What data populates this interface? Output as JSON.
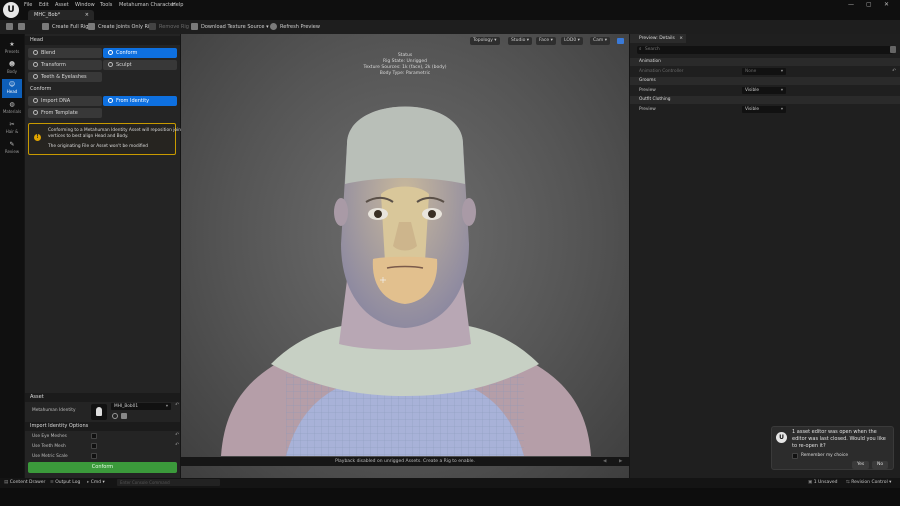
{
  "menu": {
    "file": "File",
    "edit": "Edit",
    "asset": "Asset",
    "window": "Window",
    "tools": "Tools",
    "metahuman": "Metahuman Character",
    "help": "Help"
  },
  "tab": {
    "title": "MHC_Bob*",
    "close": "×"
  },
  "window_controls": {
    "minimize": "—",
    "maximize": "▢",
    "close": "✕"
  },
  "toolbar": {
    "create_full_rig": "Create Full Rig",
    "create_joints_only": "Create Joints Only Rig",
    "remove_rig": "Remove Rig",
    "download_textures": "Download Texture Source ▾",
    "refresh_preview": "Refresh Preview"
  },
  "strip": [
    {
      "icon": "★",
      "label": "Presets"
    },
    {
      "icon": "☻",
      "label": "Body"
    },
    {
      "icon": "☺",
      "label": "Head"
    },
    {
      "icon": "◍",
      "label": "Materials"
    },
    {
      "icon": "✂",
      "label": "Hair &"
    },
    {
      "icon": "✎",
      "label": "Review"
    }
  ],
  "panel": {
    "head_header": "Head",
    "blend": "Blend",
    "conform": "Conform",
    "transform": "Transform",
    "sculpt": "Sculpt",
    "teeth": "Teeth & Eyelashes",
    "conform_header": "Conform",
    "import_dna": "Import DNA",
    "from_identity": "From Identity",
    "from_template": "From Template",
    "warning_line1": "Conforming to a Metahuman Identity Asset will reposition joint",
    "warning_line2": "vertices to best align Head and Body.",
    "warning_line3": "The originating File or Asset won't be modified",
    "asset_header": "Asset",
    "identity_label": "Metahuman Identity",
    "identity_value": "MHI_Bob01",
    "import_options_header": "Import Identity Options",
    "use_eye_meshes": "Use Eye Meshes",
    "use_teeth_mesh": "Use Teeth Mesh",
    "use_metric_scale": "Use Metric Scale",
    "reset": "↶",
    "confirm": "Conform"
  },
  "viewport": {
    "topology": "Topology ▾",
    "studio": "Studio ▾",
    "face": "Face ▾",
    "lod": "LOD0 ▾",
    "cam": "Cam ▾",
    "status_title": "Status",
    "rig_state": "Rig State: Unrigged",
    "texture_sources": "Texture Sources: 1k (face), 2k (body)",
    "body_type": "Body Type: Parametric",
    "playback": "Playback disabled on unrigged Assets. Create a Rig to enable."
  },
  "right": {
    "tab": "Preview: Details",
    "close": "×",
    "search_placeholder": "Search",
    "animation_header": "Animation",
    "animation_row": "Animation Controller",
    "animation_value": "None",
    "groom_header": "Grooms",
    "groom_row": "Preview",
    "groom_value": "Visible",
    "outfit_header": "Outfit Clothing",
    "outfit_row": "Preview",
    "outfit_value": "Visible"
  },
  "toast": {
    "line1": "1 asset editor was open when the",
    "line2": "editor was last closed. Would you like",
    "line3": "to re-open it?",
    "remember": "Remember my choice",
    "yes": "Yes",
    "no": "No"
  },
  "statusbar": {
    "content_drawer": "Content Drawer",
    "output_log": "Output Log",
    "cmd": "Cmd ▾",
    "cmd_placeholder": "Enter Console Command",
    "unsaved": "1 Unsaved",
    "revision_control": "Revision Control ▾"
  },
  "colors": {
    "accent": "#0e70e0",
    "confirm": "#3b9a3b",
    "warning": "#c89a00"
  }
}
